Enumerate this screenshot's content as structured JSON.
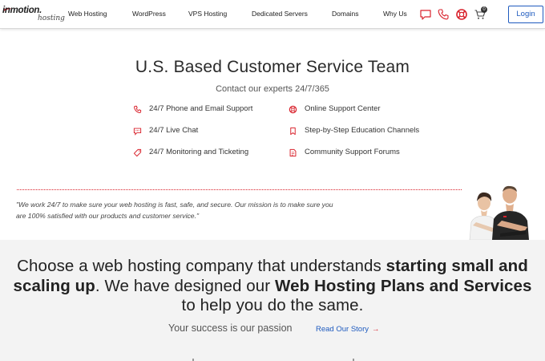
{
  "brand": {
    "name_main": "inmotion.",
    "name_sub": "hosting"
  },
  "nav": {
    "items": [
      "Web Hosting",
      "WordPress",
      "VPS Hosting",
      "Dedicated Servers",
      "Domains",
      "Why Us"
    ],
    "icons": [
      "chat-icon",
      "phone-icon",
      "support-lifebuoy-icon",
      "cart-icon"
    ],
    "cart_count": "0",
    "login_label": "Login"
  },
  "service": {
    "title": "U.S. Based Customer Service Team",
    "subtitle": "Contact our experts 24/7/365",
    "features_left": [
      {
        "icon": "phone-icon",
        "label": "24/7 Phone and Email Support"
      },
      {
        "icon": "chat-icon",
        "label": "24/7 Live Chat"
      },
      {
        "icon": "tag-icon",
        "label": "24/7 Monitoring and Ticketing"
      }
    ],
    "features_right": [
      {
        "icon": "lifebuoy-icon",
        "label": "Online Support Center"
      },
      {
        "icon": "bookmark-icon",
        "label": "Step-by-Step Education Channels"
      },
      {
        "icon": "document-icon",
        "label": "Community Support Forums"
      }
    ],
    "quote": "\"We work 24/7 to make sure your web hosting is fast, safe, and secure. Our mission is to make sure you are 100% satisfied with our products and customer service.\""
  },
  "band": {
    "headline_parts": [
      {
        "text": "Choose a web hosting company that understands ",
        "bold": false
      },
      {
        "text": "starting small and scaling up",
        "bold": true
      },
      {
        "text": ". We have designed our ",
        "bold": false
      },
      {
        "text": "Web Hosting Plans and Services",
        "bold": true
      },
      {
        "text": " to help you do the same.",
        "bold": false
      }
    ],
    "passion": "Your success is our passion",
    "story_link": "Read Our Story",
    "story_arrow": "→"
  },
  "colors": {
    "accent_red": "#d9232d",
    "link_blue": "#1f5bbf",
    "band_bg": "#f3f3f3"
  }
}
